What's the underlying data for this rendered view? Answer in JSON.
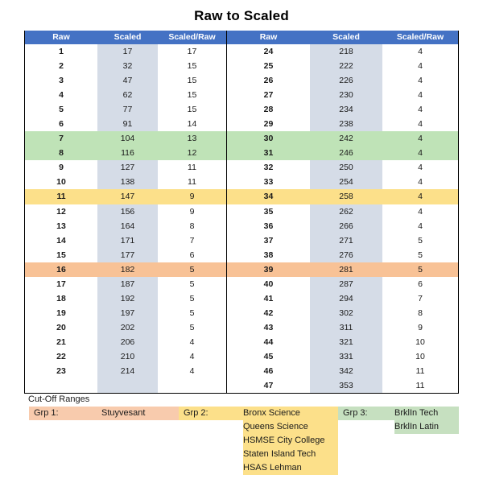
{
  "title": "Raw to Scaled",
  "table": {
    "columns": [
      "Raw",
      "Scaled",
      "Scaled/Raw"
    ],
    "left_rows": [
      {
        "raw": "1",
        "scaled": "17",
        "ratio": "17",
        "hl": ""
      },
      {
        "raw": "2",
        "scaled": "32",
        "ratio": "15",
        "hl": ""
      },
      {
        "raw": "3",
        "scaled": "47",
        "ratio": "15",
        "hl": ""
      },
      {
        "raw": "4",
        "scaled": "62",
        "ratio": "15",
        "hl": ""
      },
      {
        "raw": "5",
        "scaled": "77",
        "ratio": "15",
        "hl": ""
      },
      {
        "raw": "6",
        "scaled": "91",
        "ratio": "14",
        "hl": ""
      },
      {
        "raw": "7",
        "scaled": "104",
        "ratio": "13",
        "hl": ""
      },
      {
        "raw": "8",
        "scaled": "116",
        "ratio": "12",
        "hl": ""
      },
      {
        "raw": "9",
        "scaled": "127",
        "ratio": "11",
        "hl": ""
      },
      {
        "raw": "10",
        "scaled": "138",
        "ratio": "11",
        "hl": ""
      },
      {
        "raw": "11",
        "scaled": "147",
        "ratio": "9",
        "hl": ""
      },
      {
        "raw": "12",
        "scaled": "156",
        "ratio": "9",
        "hl": ""
      },
      {
        "raw": "13",
        "scaled": "164",
        "ratio": "8",
        "hl": ""
      },
      {
        "raw": "14",
        "scaled": "171",
        "ratio": "7",
        "hl": ""
      },
      {
        "raw": "15",
        "scaled": "177",
        "ratio": "6",
        "hl": ""
      },
      {
        "raw": "16",
        "scaled": "182",
        "ratio": "5",
        "hl": ""
      },
      {
        "raw": "17",
        "scaled": "187",
        "ratio": "5",
        "hl": ""
      },
      {
        "raw": "18",
        "scaled": "192",
        "ratio": "5",
        "hl": ""
      },
      {
        "raw": "19",
        "scaled": "197",
        "ratio": "5",
        "hl": ""
      },
      {
        "raw": "20",
        "scaled": "202",
        "ratio": "5",
        "hl": ""
      },
      {
        "raw": "21",
        "scaled": "206",
        "ratio": "4",
        "hl": ""
      },
      {
        "raw": "22",
        "scaled": "210",
        "ratio": "4",
        "hl": ""
      },
      {
        "raw": "23",
        "scaled": "214",
        "ratio": "4",
        "hl": ""
      },
      {
        "raw": "",
        "scaled": "",
        "ratio": "",
        "hl": ""
      }
    ],
    "right_rows": [
      {
        "raw": "24",
        "scaled": "218",
        "ratio": "4",
        "hl": ""
      },
      {
        "raw": "25",
        "scaled": "222",
        "ratio": "4",
        "hl": ""
      },
      {
        "raw": "26",
        "scaled": "226",
        "ratio": "4",
        "hl": ""
      },
      {
        "raw": "27",
        "scaled": "230",
        "ratio": "4",
        "hl": ""
      },
      {
        "raw": "28",
        "scaled": "234",
        "ratio": "4",
        "hl": ""
      },
      {
        "raw": "29",
        "scaled": "238",
        "ratio": "4",
        "hl": ""
      },
      {
        "raw": "30",
        "scaled": "242",
        "ratio": "4",
        "hl": "hl-green"
      },
      {
        "raw": "31",
        "scaled": "246",
        "ratio": "4",
        "hl": "hl-green"
      },
      {
        "raw": "32",
        "scaled": "250",
        "ratio": "4",
        "hl": ""
      },
      {
        "raw": "33",
        "scaled": "254",
        "ratio": "4",
        "hl": ""
      },
      {
        "raw": "34",
        "scaled": "258",
        "ratio": "4",
        "hl": "hl-yellow"
      },
      {
        "raw": "35",
        "scaled": "262",
        "ratio": "4",
        "hl": ""
      },
      {
        "raw": "36",
        "scaled": "266",
        "ratio": "4",
        "hl": ""
      },
      {
        "raw": "37",
        "scaled": "271",
        "ratio": "5",
        "hl": ""
      },
      {
        "raw": "38",
        "scaled": "276",
        "ratio": "5",
        "hl": ""
      },
      {
        "raw": "39",
        "scaled": "281",
        "ratio": "5",
        "hl": "hl-orange"
      },
      {
        "raw": "40",
        "scaled": "287",
        "ratio": "6",
        "hl": ""
      },
      {
        "raw": "41",
        "scaled": "294",
        "ratio": "7",
        "hl": ""
      },
      {
        "raw": "42",
        "scaled": "302",
        "ratio": "8",
        "hl": ""
      },
      {
        "raw": "43",
        "scaled": "311",
        "ratio": "9",
        "hl": ""
      },
      {
        "raw": "44",
        "scaled": "321",
        "ratio": "10",
        "hl": ""
      },
      {
        "raw": "45",
        "scaled": "331",
        "ratio": "10",
        "hl": ""
      },
      {
        "raw": "46",
        "scaled": "342",
        "ratio": "11",
        "hl": ""
      },
      {
        "raw": "47",
        "scaled": "353",
        "ratio": "11",
        "hl": ""
      }
    ]
  },
  "legend": {
    "title": "Cut-Off Ranges",
    "groups": [
      {
        "label": "Grp 1:",
        "color": "#F8CBAD",
        "schools": [
          "Stuyvesant"
        ]
      },
      {
        "label": "Grp 2:",
        "color": "#FCE08A",
        "schools": [
          "Bronx Science",
          "Queens Science",
          "HSMSE City College",
          "Staten Island Tech",
          "HSAS Lehman"
        ]
      },
      {
        "label": "Grp 3:",
        "color": "#C6E0C0",
        "schools": [
          "BrklIn Tech",
          "BrklIn Latin"
        ]
      }
    ]
  },
  "colors": {
    "header_blue": "#4472C4",
    "shaded_column": "#D5DCE7",
    "highlight_green": "#BFE3B7",
    "highlight_yellow": "#FCE08A",
    "highlight_orange": "#F8C296"
  },
  "chart_data": {
    "type": "table",
    "title": "Raw to Scaled",
    "columns": [
      "Raw",
      "Scaled",
      "Scaled/Raw"
    ],
    "x": [
      1,
      2,
      3,
      4,
      5,
      6,
      7,
      8,
      9,
      10,
      11,
      12,
      13,
      14,
      15,
      16,
      17,
      18,
      19,
      20,
      21,
      22,
      23,
      24,
      25,
      26,
      27,
      28,
      29,
      30,
      31,
      32,
      33,
      34,
      35,
      36,
      37,
      38,
      39,
      40,
      41,
      42,
      43,
      44,
      45,
      46,
      47
    ],
    "series": [
      {
        "name": "Scaled",
        "values": [
          17,
          32,
          47,
          62,
          77,
          91,
          104,
          116,
          127,
          138,
          147,
          156,
          164,
          171,
          177,
          182,
          187,
          192,
          197,
          202,
          206,
          210,
          214,
          218,
          222,
          226,
          230,
          234,
          238,
          242,
          246,
          250,
          254,
          258,
          262,
          266,
          271,
          276,
          281,
          287,
          294,
          302,
          311,
          321,
          331,
          342,
          353
        ]
      },
      {
        "name": "Scaled/Raw",
        "values": [
          17,
          15,
          15,
          15,
          15,
          14,
          13,
          12,
          11,
          11,
          9,
          9,
          8,
          7,
          6,
          5,
          5,
          5,
          5,
          5,
          4,
          4,
          4,
          4,
          4,
          4,
          4,
          4,
          4,
          4,
          4,
          4,
          4,
          4,
          4,
          4,
          5,
          5,
          5,
          6,
          7,
          8,
          9,
          10,
          10,
          11,
          11
        ]
      }
    ],
    "xlabel": "Raw",
    "ylabel": "Scaled",
    "annotations": [
      {
        "rows": [
          30,
          31
        ],
        "color": "#BFE3B7",
        "group": "Grp 3"
      },
      {
        "rows": [
          34
        ],
        "color": "#FCE08A",
        "group": "Grp 2"
      },
      {
        "rows": [
          39
        ],
        "color": "#F8C296",
        "group": "Grp 1"
      }
    ]
  }
}
